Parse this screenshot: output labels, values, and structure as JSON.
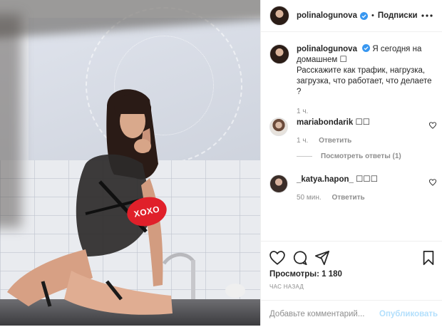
{
  "colors": {
    "text": "#262626",
    "secondary": "#8e8e8e",
    "verified_blue": "#3897f0",
    "publish_disabled": "#b2dffc",
    "border": "#efefef",
    "badge_red": "#e0202a"
  },
  "photo": {
    "badge_text": "XOXO"
  },
  "header": {
    "username": "polinalogunova",
    "dot": "•",
    "follow_label": "Подписки"
  },
  "caption": {
    "username": "polinalogunova",
    "text_line1": "Я сегодня на",
    "text_line2": "домашнем ☐",
    "text_line3": "Расскажите как трафик, нагрузка,",
    "text_line4": "загрузка, что работает, что делаете ?",
    "time": "1 ч."
  },
  "comments": [
    {
      "username": "mariabondarik",
      "text": "☐☐",
      "time": "1 ч.",
      "reply_label": "Ответить"
    },
    {
      "username": "_katya.hapon_",
      "text": "☐☐☐",
      "time": "50 мин.",
      "reply_label": "Ответить"
    }
  ],
  "view_replies_label": "Посмотреть ответы (1)",
  "actions": {
    "icons": [
      "heart-icon",
      "comment-icon",
      "share-icon",
      "bookmark-icon"
    ],
    "views_label": "Просмотры: 1 180",
    "posted_label": "час назад"
  },
  "add_comment": {
    "placeholder": "Добавьте комментарий...",
    "publish_label": "Опубликовать"
  }
}
